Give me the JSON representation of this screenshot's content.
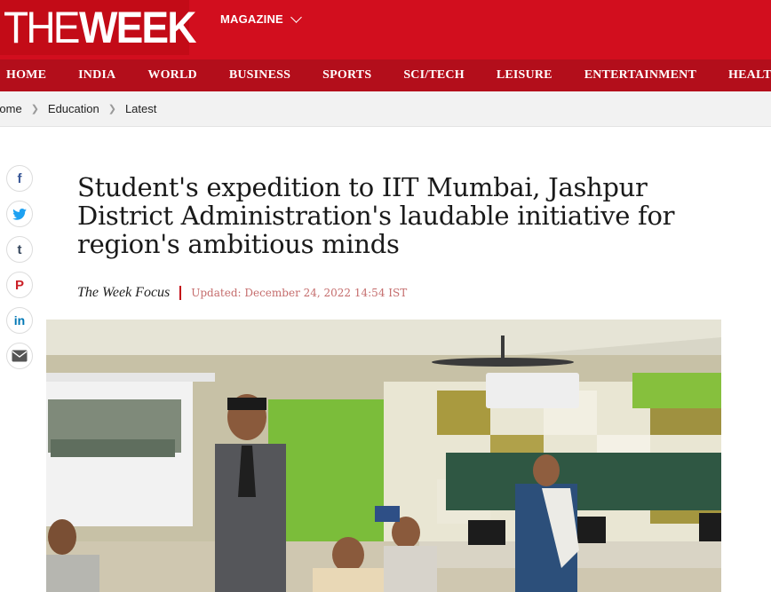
{
  "header": {
    "logo_the": "THE",
    "logo_week": "WEEK",
    "magazine_label": "MAGAZINE",
    "brand_color": "#d20e1e"
  },
  "nav": {
    "items": [
      "HOME",
      "INDIA",
      "WORLD",
      "BUSINESS",
      "SPORTS",
      "SCI/TECH",
      "LEISURE",
      "ENTERTAINMENT",
      "HEALTH"
    ]
  },
  "breadcrumb": {
    "items": [
      "Home",
      "Education",
      "Latest"
    ]
  },
  "share": {
    "icons": [
      "facebook-icon",
      "twitter-icon",
      "tumblr-icon",
      "pinterest-icon",
      "linkedin-icon",
      "mail-icon"
    ]
  },
  "article": {
    "headline": "Student's expedition to IIT Mumbai, Jashpur District Administration's laudable initiative for region's ambitious minds",
    "author": "The Week Focus",
    "updated": "Updated: December 24, 2022 14:54 IST"
  }
}
